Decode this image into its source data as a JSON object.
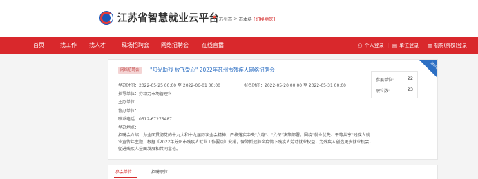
{
  "header": {
    "site_title": "江苏省智慧就业云平台",
    "location_city": "苏州市",
    "location_level": "市本级",
    "switch_label": "[切换地区]"
  },
  "nav": {
    "items": [
      "首页",
      "找工作",
      "找人才",
      "现场招聘会",
      "网络招聘会",
      "在线直播"
    ],
    "personal_login": "个人登录",
    "company_login": "单位登录",
    "agency_login": "机构(院校)登录"
  },
  "fair": {
    "badge": "网络招聘会",
    "title": "\"阳光助残 放飞爱心\" 2022年苏州市残疾人网络招聘会",
    "ribbon": "进行中",
    "hold_time_label": "举办时间：",
    "hold_time_value": "2022-05-25 00:00 至 2022-06-01 00:00",
    "signup_time_label": "报名时间：",
    "signup_time_value": "2022-05-20 00:00 至 2022-05-31 00:00",
    "guide_unit_label": "指导单位：",
    "guide_unit_value": "劳动力市场管理科",
    "host_unit_label": "主办单位：",
    "host_unit_value": "",
    "co_unit_label": "协办单位：",
    "co_unit_value": "",
    "phone_label": "联系电话：",
    "phone_value": "0512-67275487",
    "address_label": "举办地点：",
    "address_value": "",
    "intro_label": "招聘会介绍：",
    "intro_value": "为全面贯彻党的十九大和十九届历次全会精神，严格落实中央\"六稳\"、\"六保\"决策部署，围绕\"就业优先、平等共享\"残疾人就业宣传年主题，根据《2022年苏州市残疾人就业工作要点》安排，保障新冠肺炎疫情下残疾人劳动就业权益，为残疾人创造更多就业机会，促进残疾人全面发展和共同富裕。"
  },
  "stats": {
    "units_label": "参展单位:",
    "units_value": "22",
    "jobs_label": "职位数:",
    "jobs_value": "23"
  },
  "tabs": {
    "items": [
      "参会单位",
      "招聘职位"
    ]
  }
}
